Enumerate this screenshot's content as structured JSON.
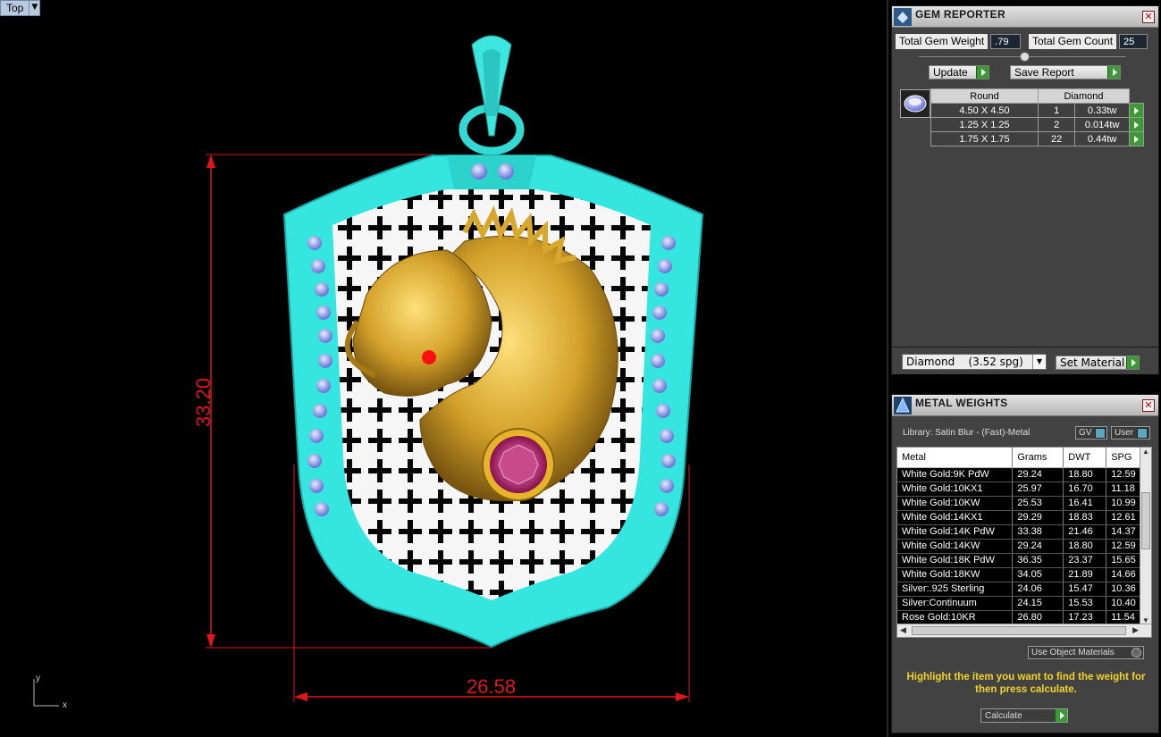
{
  "viewport": {
    "label": "Top",
    "height_dim": "33.20",
    "width_dim": "26.58",
    "axis_y": "y",
    "axis_x": "x"
  },
  "gem_reporter": {
    "title": "GEM REPORTER",
    "total_weight_label": "Total Gem Weight",
    "total_weight_value": ".79",
    "total_count_label": "Total Gem Count",
    "total_count_value": "25",
    "update_label": "Update",
    "save_label": "Save Report",
    "table": {
      "shape": "Round",
      "stone": "Diamond",
      "rows": [
        {
          "size": "4.50 X 4.50",
          "count": "1",
          "weight": "0.33tw"
        },
        {
          "size": "1.25 X 1.25",
          "count": "2",
          "weight": "0.014tw"
        },
        {
          "size": "1.75 X 1.75",
          "count": "22",
          "weight": "0.44tw"
        }
      ]
    },
    "material_select": "Diamond    (3.52 spg)",
    "set_material_label": "Set Material"
  },
  "metal_weights": {
    "title": "METAL WEIGHTS",
    "library": "Library: Satin Blur - (Fast)-Metal",
    "gv_label": "GV",
    "user_label": "User",
    "columns": [
      "Metal",
      "Grams",
      "DWT",
      "SPG"
    ],
    "rows": [
      {
        "metal": "White Gold:9K PdW",
        "grams": "29.24",
        "dwt": "18.80",
        "spg": "12.59"
      },
      {
        "metal": "White Gold:10KX1",
        "grams": "25.97",
        "dwt": "16.70",
        "spg": "11.18"
      },
      {
        "metal": "White Gold:10KW",
        "grams": "25.53",
        "dwt": "16.41",
        "spg": "10.99"
      },
      {
        "metal": "White Gold:14KX1",
        "grams": "29.29",
        "dwt": "18.83",
        "spg": "12.61"
      },
      {
        "metal": "White Gold:14K PdW",
        "grams": "33.38",
        "dwt": "21.46",
        "spg": "14.37"
      },
      {
        "metal": "White Gold:14KW",
        "grams": "29.24",
        "dwt": "18.80",
        "spg": "12.59"
      },
      {
        "metal": "White Gold:18K PdW",
        "grams": "36.35",
        "dwt": "23.37",
        "spg": "15.65"
      },
      {
        "metal": "White Gold:18KW",
        "grams": "34.05",
        "dwt": "21.89",
        "spg": "14.66"
      },
      {
        "metal": "Silver:.925 Sterling",
        "grams": "24.06",
        "dwt": "15.47",
        "spg": "10.36"
      },
      {
        "metal": "Silver:Continuum",
        "grams": "24.15",
        "dwt": "15.53",
        "spg": "10.40"
      },
      {
        "metal": "Rose Gold:10KR",
        "grams": "26.80",
        "dwt": "17.23",
        "spg": "11.54"
      }
    ],
    "use_object_materials": "Use Object Materials",
    "hint": "Highlight the item you want to find the weight for then press calculate.",
    "calculate_label": "Calculate"
  },
  "colors": {
    "dimension": "#e0161b",
    "frame": "#35e6e0",
    "gold": "#c99a1f",
    "hint": "#f3d22a"
  }
}
